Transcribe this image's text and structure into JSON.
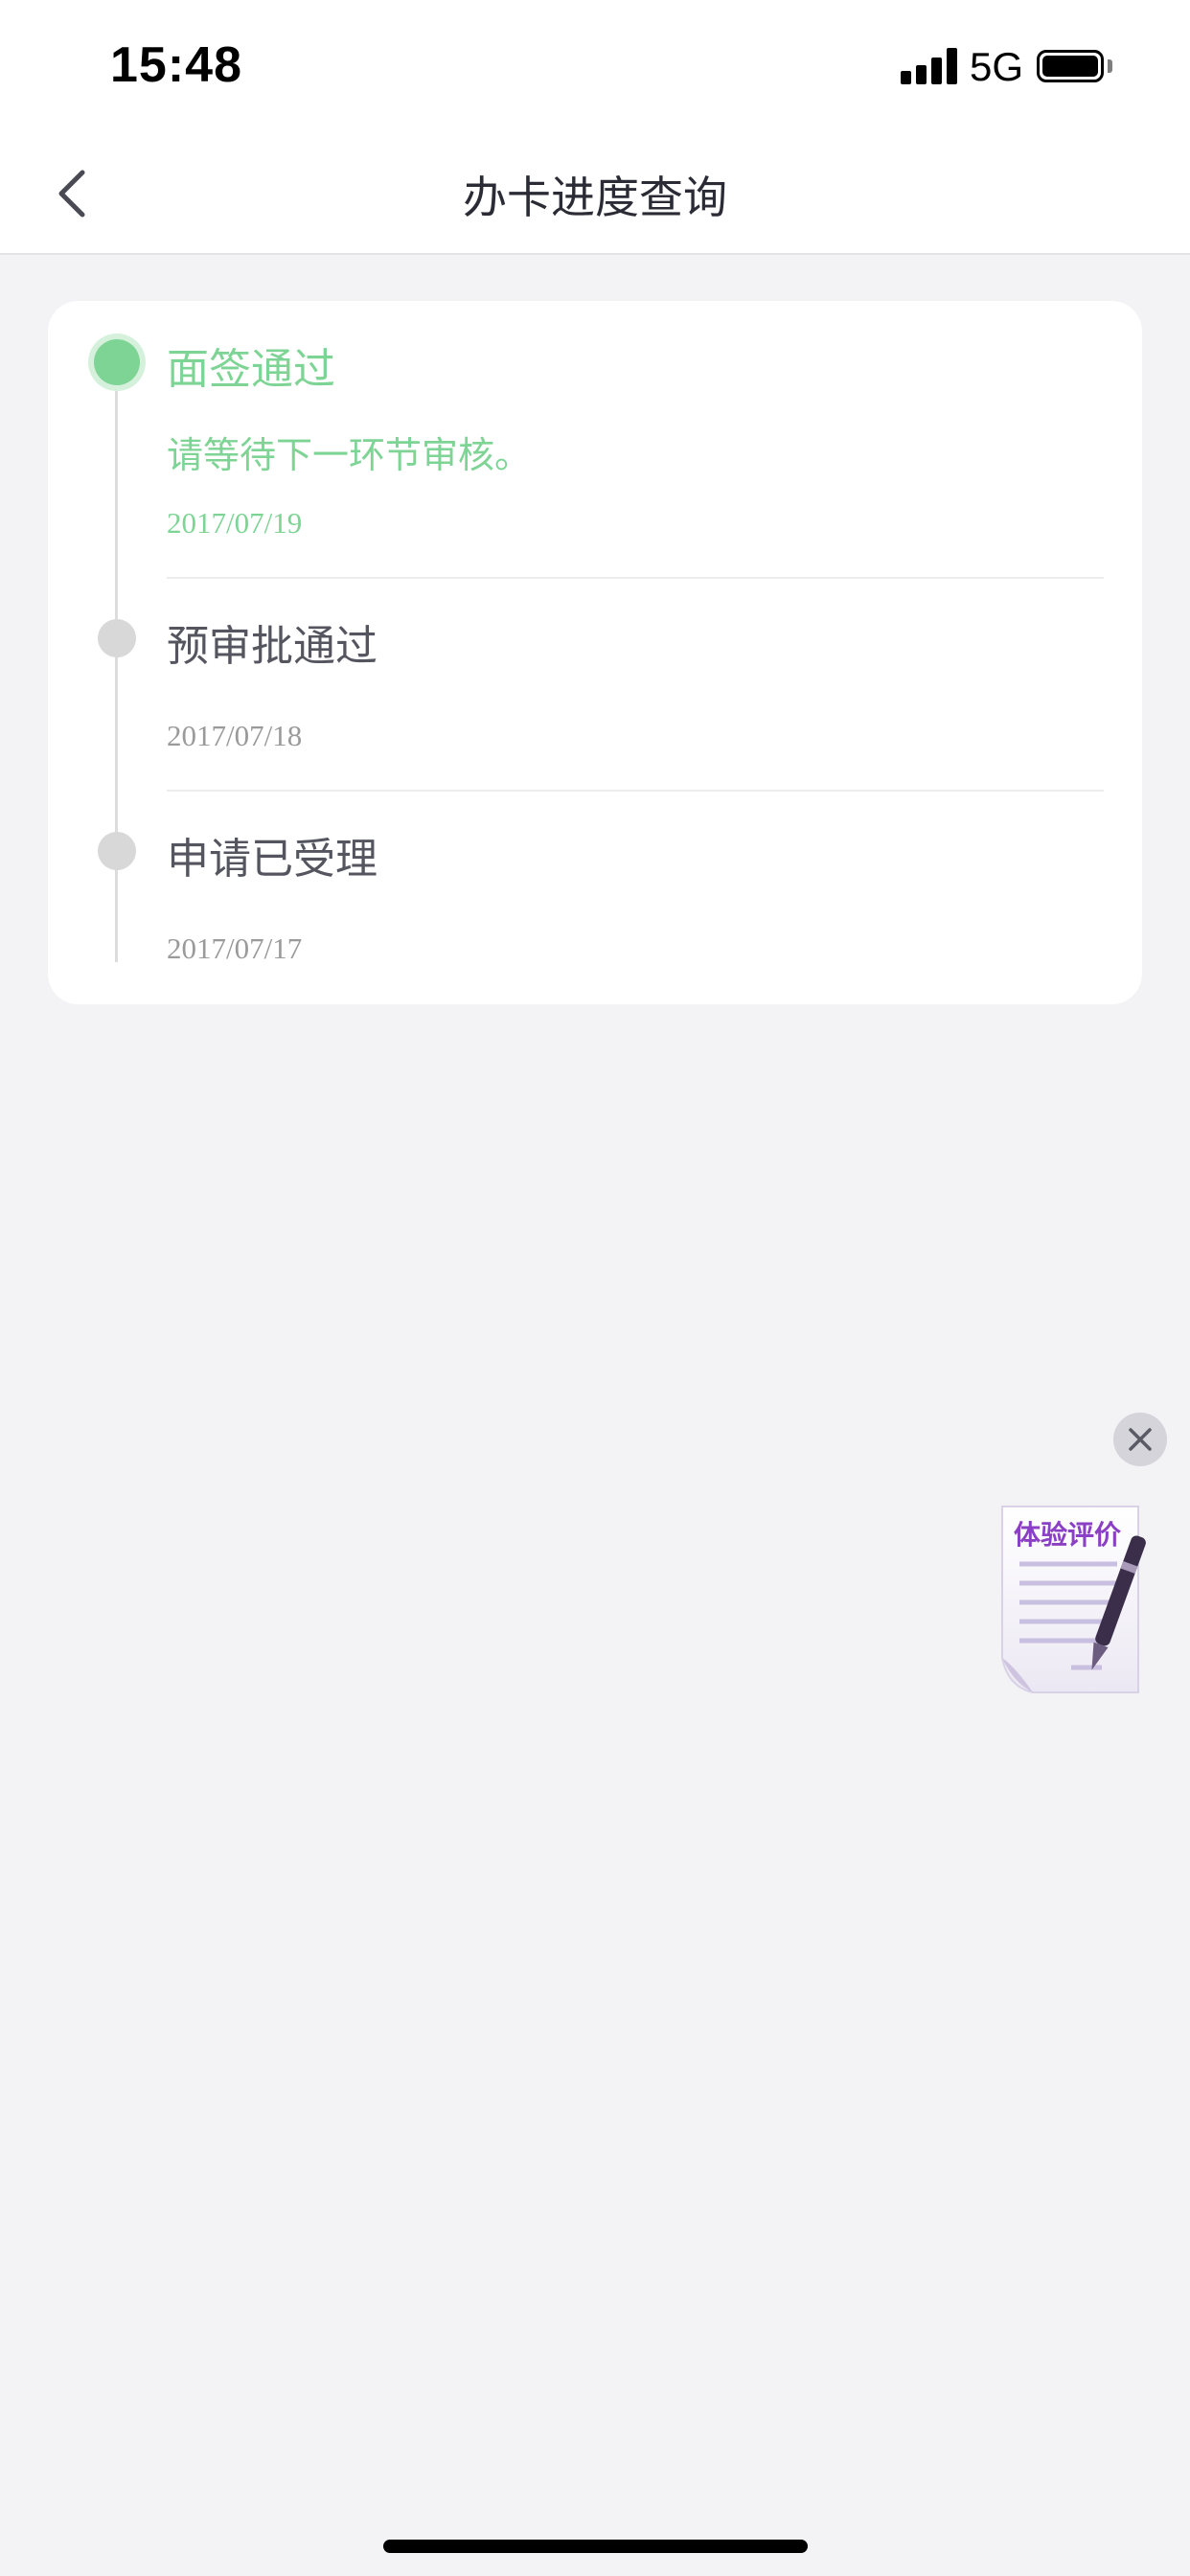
{
  "status_bar": {
    "time": "15:48",
    "network": "5G",
    "battery_level": 1.0
  },
  "nav": {
    "title": "办卡进度查询",
    "back_icon": "chevron-left-icon"
  },
  "timeline": {
    "steps": [
      {
        "title": "面签通过",
        "description": "请等待下一环节审核。",
        "date": "2017/07/19",
        "status": "active"
      },
      {
        "title": "预审批通过",
        "description": "",
        "date": "2017/07/18",
        "status": "done"
      },
      {
        "title": "申请已受理",
        "description": "",
        "date": "2017/07/17",
        "status": "done"
      }
    ]
  },
  "feedback": {
    "label": "体验评价",
    "close_icon": "close-icon",
    "icon": "document-pen-icon"
  },
  "colors": {
    "accent_green": "#7ed495",
    "inactive_gray": "#d8d8d8",
    "background": "#f3f3f6",
    "feedback_purple": "#8a3fc4"
  }
}
